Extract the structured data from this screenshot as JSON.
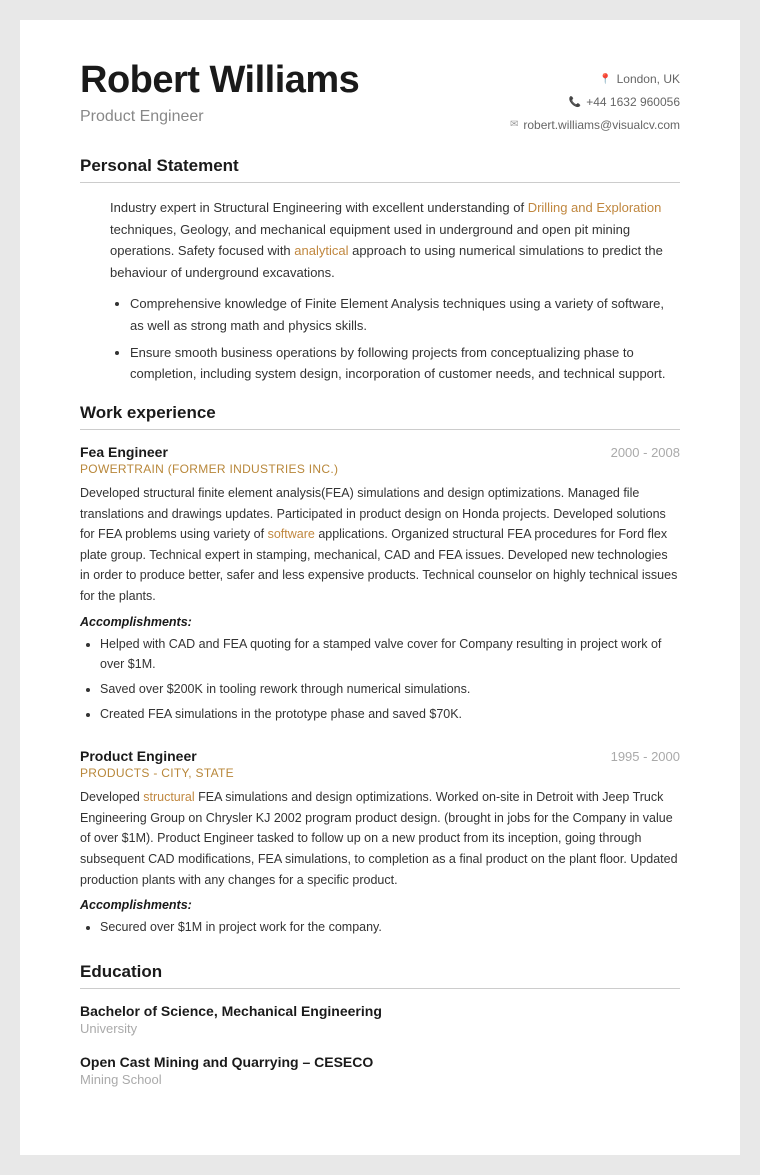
{
  "header": {
    "name": "Robert Williams",
    "title": "Product Engineer",
    "contact": {
      "location": "London, UK",
      "phone": "+44 1632 960056",
      "email": "robert.williams@visualcv.com"
    }
  },
  "sections": {
    "personal_statement": {
      "label": "Personal Statement",
      "intro": "Industry expert in Structural Engineering with excellent understanding of Drilling and Exploration techniques, Geology, and mechanical equipment used in underground and open pit mining operations. Safety focused with analytical approach to using numerical simulations to predict the behaviour of underground excavations.",
      "bullets": [
        "Comprehensive knowledge of Finite Element Analysis techniques using a variety of software, as well as strong math and physics skills.",
        "Ensure smooth business operations by following projects from conceptualizing phase to completion, including system design, incorporation of customer needs, and technical support."
      ]
    },
    "work_experience": {
      "label": "Work experience",
      "jobs": [
        {
          "title": "Fea Engineer",
          "company": "POWERTRAIN (FORMER INDUSTRIES INC.)",
          "dates": "2000 - 2008",
          "description": "Developed structural finite element analysis(FEA) simulations and design optimizations. Managed file translations and drawings updates. Participated in product design on Honda projects. Developed solutions for FEA problems using variety of software applications. Organized structural FEA procedures for Ford flex plate group. Technical expert in stamping, mechanical, CAD and FEA issues. Developed new technologies in order to produce better, safer and less expensive products. Technical counselor on highly technical issues for the plants.",
          "accomplishments_label": "Accomplishments:",
          "accomplishments": [
            "Helped with CAD and FEA quoting for a stamped valve cover for Company resulting in project work of over $1M.",
            "Saved over $200K in tooling rework through numerical simulations.",
            "Created FEA simulations in the prototype phase and saved $70K."
          ]
        },
        {
          "title": "Product Engineer",
          "company": "PRODUCTS - CITY, STATE",
          "dates": "1995 - 2000",
          "description": "Developed structural FEA simulations and design optimizations. Worked on-site in Detroit with Jeep Truck Engineering Group on Chrysler KJ 2002 program product design. (brought in jobs for the Company in value of over $1M). Product Engineer tasked to follow up on a new product from its inception, going through subsequent CAD modifications, FEA simulations, to completion as a final product on the plant floor. Updated production plants with any changes for a specific product.",
          "accomplishments_label": "Accomplishments:",
          "accomplishments": [
            "Secured over $1M in project work for the company."
          ]
        }
      ]
    },
    "education": {
      "label": "Education",
      "items": [
        {
          "degree": "Bachelor of Science, Mechanical Engineering",
          "school": "University"
        },
        {
          "degree": "Open Cast Mining and Quarrying – CESECO",
          "school": "Mining School"
        }
      ]
    }
  }
}
